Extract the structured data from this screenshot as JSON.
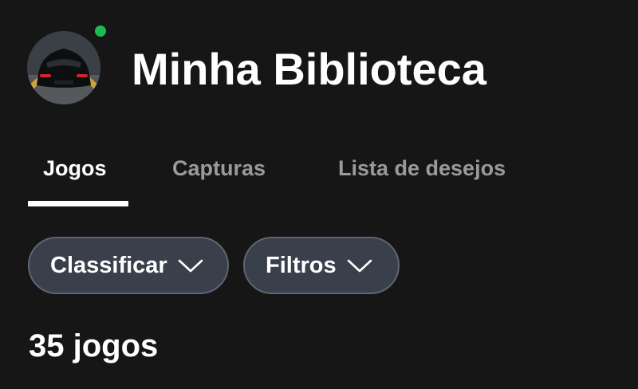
{
  "header": {
    "title": "Minha Biblioteca",
    "avatar_icon": "car-avatar",
    "presence_color": "#1db954"
  },
  "tabs": [
    {
      "label": "Jogos",
      "active": true
    },
    {
      "label": "Capturas",
      "active": false
    },
    {
      "label": "Lista de desejos",
      "active": false
    }
  ],
  "toolbar": {
    "sort_label": "Classificar",
    "filter_label": "Filtros",
    "chevron_icon": "chevron-down-icon"
  },
  "library": {
    "count_label": "35 jogos"
  },
  "colors": {
    "background": "#161616",
    "pill_background": "#3a404b",
    "pill_border": "#5e6571",
    "inactive_tab": "#9a9a9a"
  }
}
